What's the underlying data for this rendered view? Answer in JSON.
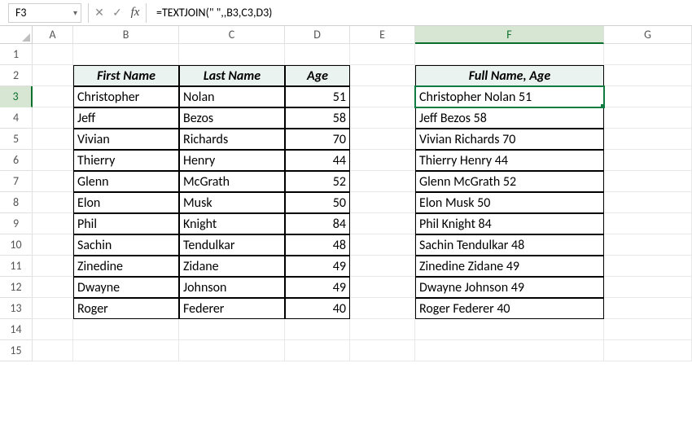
{
  "formulaBar": {
    "nameBox": "F3",
    "fxLabel": "fx",
    "cancelGlyph": "✕",
    "confirmGlyph": "✓",
    "formula": "=TEXTJOIN(\" \",,B3,C3,D3)"
  },
  "columns": [
    "A",
    "B",
    "C",
    "D",
    "E",
    "F",
    "G"
  ],
  "rows": [
    "1",
    "2",
    "3",
    "4",
    "5",
    "6",
    "7",
    "8",
    "9",
    "10",
    "11",
    "12",
    "13",
    "14",
    "15"
  ],
  "headers": {
    "firstName": "First Name",
    "lastName": "Last Name",
    "age": "Age",
    "fullNameAge": "Full Name, Age"
  },
  "data": [
    {
      "first": "Christopher",
      "last": "Nolan",
      "age": "51",
      "full": "Christopher Nolan 51"
    },
    {
      "first": "Jeff",
      "last": "Bezos",
      "age": "58",
      "full": "Jeff Bezos 58"
    },
    {
      "first": "Vivian",
      "last": "Richards",
      "age": "70",
      "full": "Vivian Richards 70"
    },
    {
      "first": "Thierry",
      "last": "Henry",
      "age": "44",
      "full": "Thierry Henry 44"
    },
    {
      "first": "Glenn",
      "last": "McGrath",
      "age": "52",
      "full": "Glenn McGrath 52"
    },
    {
      "first": "Elon",
      "last": "Musk",
      "age": "50",
      "full": "Elon Musk 50"
    },
    {
      "first": "Phil",
      "last": "Knight",
      "age": "84",
      "full": "Phil Knight 84"
    },
    {
      "first": "Sachin",
      "last": "Tendulkar",
      "age": "48",
      "full": "Sachin Tendulkar 48"
    },
    {
      "first": "Zinedine",
      "last": "Zidane",
      "age": "49",
      "full": "Zinedine Zidane 49"
    },
    {
      "first": "Dwayne",
      "last": "Johnson",
      "age": "49",
      "full": "Dwayne Johnson 49"
    },
    {
      "first": "Roger",
      "last": "Federer",
      "age": "40",
      "full": "Roger Federer 40"
    }
  ],
  "activeCell": "F3",
  "chart_data": {
    "type": "table",
    "columns": [
      "First Name",
      "Last Name",
      "Age",
      "Full Name, Age"
    ],
    "rows": [
      [
        "Christopher",
        "Nolan",
        51,
        "Christopher Nolan 51"
      ],
      [
        "Jeff",
        "Bezos",
        58,
        "Jeff Bezos 58"
      ],
      [
        "Vivian",
        "Richards",
        70,
        "Vivian Richards 70"
      ],
      [
        "Thierry",
        "Henry",
        44,
        "Thierry Henry 44"
      ],
      [
        "Glenn",
        "McGrath",
        52,
        "Glenn McGrath 52"
      ],
      [
        "Elon",
        "Musk",
        50,
        "Elon Musk 50"
      ],
      [
        "Phil",
        "Knight",
        84,
        "Phil Knight 84"
      ],
      [
        "Sachin",
        "Tendulkar",
        48,
        "Sachin Tendulkar 48"
      ],
      [
        "Zinedine",
        "Zidane",
        49,
        "Zinedine Zidane 49"
      ],
      [
        "Dwayne",
        "Johnson",
        49,
        "Dwayne Johnson 49"
      ],
      [
        "Roger",
        "Federer",
        40,
        "Roger Federer 40"
      ]
    ]
  }
}
